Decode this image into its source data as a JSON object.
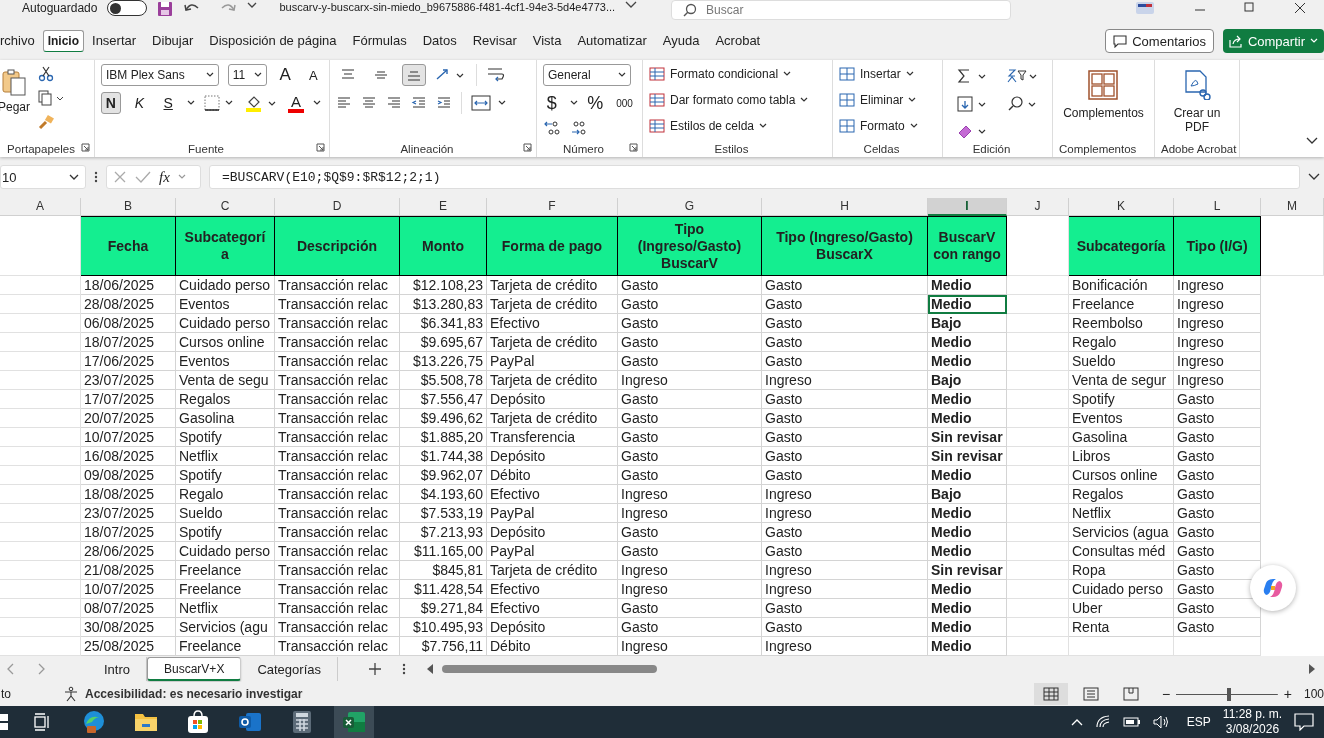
{
  "title_bar": {
    "autosave_label": "Autoguardado",
    "autosave_on": false,
    "filename": "buscarv-y-buscarx-sin-miedo_b9675886-f481-4cf1-94e3-5d4e4773...",
    "search_placeholder": "Buscar"
  },
  "menu_tabs": [
    {
      "label": "rchivo",
      "selected": false
    },
    {
      "label": "Inicio",
      "selected": true
    },
    {
      "label": "Insertar",
      "selected": false
    },
    {
      "label": "Dibujar",
      "selected": false
    },
    {
      "label": "Disposición de página",
      "selected": false
    },
    {
      "label": "Fórmulas",
      "selected": false
    },
    {
      "label": "Datos",
      "selected": false
    },
    {
      "label": "Revisar",
      "selected": false
    },
    {
      "label": "Vista",
      "selected": false
    },
    {
      "label": "Automatizar",
      "selected": false
    },
    {
      "label": "Ayuda",
      "selected": false
    },
    {
      "label": "Acrobat",
      "selected": false
    }
  ],
  "comments_button": "Comentarios",
  "share_button": "Compartir",
  "ribbon": {
    "clipboard": {
      "paste": "Pegar",
      "label": "Portapapeles"
    },
    "font": {
      "family": "IBM Plex Sans",
      "size": "11",
      "grow": "A",
      "shrink": "A",
      "bold": "N",
      "italic": "K",
      "underline": "S",
      "font_color": "A",
      "label": "Fuente"
    },
    "alignment": {
      "vertical_align": [
        {
          "selected": false
        },
        {
          "selected": false
        },
        {
          "selected": true
        }
      ],
      "label": "Alineación"
    },
    "number": {
      "format": "General",
      "currency": "$",
      "percent": "%",
      "thousands": "000",
      "label": "Número"
    },
    "styles": {
      "items": [
        "Formato condicional",
        "Dar formato como tabla",
        "Estilos de celda"
      ],
      "label": "Estilos"
    },
    "cells": {
      "items": [
        "Insertar",
        "Eliminar",
        "Formato"
      ],
      "label": "Celdas"
    },
    "editing": {
      "label": "Edición"
    },
    "addins": {
      "button": "Complementos",
      "label": "Complementos"
    },
    "acrobat": {
      "button": "Crear un PDF",
      "label": "Adobe Acrobat"
    }
  },
  "formula_bar": {
    "cell_ref": "10",
    "fx_label": "fx",
    "formula": "=BUSCARV(E10;$Q$9:$R$12;2;1)"
  },
  "columns": [
    {
      "letter": "A",
      "selected": false
    },
    {
      "letter": "B",
      "selected": false
    },
    {
      "letter": "C",
      "selected": false
    },
    {
      "letter": "D",
      "selected": false
    },
    {
      "letter": "E",
      "selected": false
    },
    {
      "letter": "F",
      "selected": false
    },
    {
      "letter": "G",
      "selected": false
    },
    {
      "letter": "H",
      "selected": false
    },
    {
      "letter": "I",
      "selected": true
    },
    {
      "letter": "J",
      "selected": false
    },
    {
      "letter": "K",
      "selected": false
    },
    {
      "letter": "L",
      "selected": false
    },
    {
      "letter": "M",
      "selected": false
    }
  ],
  "table_headers": [
    "Fecha",
    "Subcategorí a",
    "Descripción",
    "Monto",
    "Forma de pago",
    "Tipo (Ingreso/Gasto) BuscarV",
    "Tipo (Ingreso/Gasto) BuscarX",
    "BuscarV con rango"
  ],
  "lookup_headers": [
    "Subcategoría",
    "Tipo (I/G)"
  ],
  "rows": [
    {
      "cells": [
        "18/06/2025",
        "Cuidado perso",
        "Transacción relac",
        "$12.108,23",
        "Tarjeta de crédito",
        "Gasto",
        "Gasto",
        "Medio"
      ],
      "lookup": [
        "Bonificación",
        "Ingreso"
      ],
      "selected": false
    },
    {
      "cells": [
        "28/08/2025",
        "Eventos",
        "Transacción relac",
        "$13.280,83",
        "Tarjeta de crédito",
        "Gasto",
        "Gasto",
        "Medio"
      ],
      "lookup": [
        "Freelance",
        "Ingreso"
      ],
      "selected": true
    },
    {
      "cells": [
        "06/08/2025",
        "Cuidado perso",
        "Transacción relac",
        "$6.341,83",
        "Efectivo",
        "Gasto",
        "Gasto",
        "Bajo"
      ],
      "lookup": [
        "Reembolso",
        "Ingreso"
      ],
      "selected": false
    },
    {
      "cells": [
        "18/07/2025",
        "Cursos online",
        "Transacción relac",
        "$9.695,67",
        "Tarjeta de crédito",
        "Gasto",
        "Gasto",
        "Medio"
      ],
      "lookup": [
        "Regalo",
        "Ingreso"
      ],
      "selected": false
    },
    {
      "cells": [
        "17/06/2025",
        "Eventos",
        "Transacción relac",
        "$13.226,75",
        "PayPal",
        "Gasto",
        "Gasto",
        "Medio"
      ],
      "lookup": [
        "Sueldo",
        "Ingreso"
      ],
      "selected": false
    },
    {
      "cells": [
        "23/07/2025",
        "Venta de segu",
        "Transacción relac",
        "$5.508,78",
        "Tarjeta de crédito",
        "Ingreso",
        "Ingreso",
        "Bajo"
      ],
      "lookup": [
        "Venta de segur",
        "Ingreso"
      ],
      "selected": false
    },
    {
      "cells": [
        "17/07/2025",
        "Regalos",
        "Transacción relac",
        "$7.556,47",
        "Depósito",
        "Gasto",
        "Gasto",
        "Medio"
      ],
      "lookup": [
        "Spotify",
        "Gasto"
      ],
      "selected": false
    },
    {
      "cells": [
        "20/07/2025",
        "Gasolina",
        "Transacción relac",
        "$9.496,62",
        "Tarjeta de crédito",
        "Gasto",
        "Gasto",
        "Medio"
      ],
      "lookup": [
        "Eventos",
        "Gasto"
      ],
      "selected": false
    },
    {
      "cells": [
        "10/07/2025",
        "Spotify",
        "Transacción relac",
        "$1.885,20",
        "Transferencia",
        "Gasto",
        "Gasto",
        "Sin revisar"
      ],
      "lookup": [
        "Gasolina",
        "Gasto"
      ],
      "selected": false
    },
    {
      "cells": [
        "16/08/2025",
        "Netflix",
        "Transacción relac",
        "$1.744,38",
        "Depósito",
        "Gasto",
        "Gasto",
        "Sin revisar"
      ],
      "lookup": [
        "Libros",
        "Gasto"
      ],
      "selected": false
    },
    {
      "cells": [
        "09/08/2025",
        "Spotify",
        "Transacción relac",
        "$9.962,07",
        "Débito",
        "Gasto",
        "Gasto",
        "Medio"
      ],
      "lookup": [
        "Cursos online",
        "Gasto"
      ],
      "selected": false
    },
    {
      "cells": [
        "18/08/2025",
        "Regalo",
        "Transacción relac",
        "$4.193,60",
        "Efectivo",
        "Ingreso",
        "Ingreso",
        "Bajo"
      ],
      "lookup": [
        "Regalos",
        "Gasto"
      ],
      "selected": false
    },
    {
      "cells": [
        "23/07/2025",
        "Sueldo",
        "Transacción relac",
        "$7.533,19",
        "PayPal",
        "Ingreso",
        "Ingreso",
        "Medio"
      ],
      "lookup": [
        "Netflix",
        "Gasto"
      ],
      "selected": false
    },
    {
      "cells": [
        "18/07/2025",
        "Spotify",
        "Transacción relac",
        "$7.213,93",
        "Depósito",
        "Gasto",
        "Gasto",
        "Medio"
      ],
      "lookup": [
        "Servicios (agua",
        "Gasto"
      ],
      "selected": false
    },
    {
      "cells": [
        "28/06/2025",
        "Cuidado perso",
        "Transacción relac",
        "$11.165,00",
        "PayPal",
        "Gasto",
        "Gasto",
        "Medio"
      ],
      "lookup": [
        "Consultas méd",
        "Gasto"
      ],
      "selected": false
    },
    {
      "cells": [
        "21/08/2025",
        "Freelance",
        "Transacción relac",
        "$845,81",
        "Tarjeta de crédito",
        "Ingreso",
        "Ingreso",
        "Sin revisar"
      ],
      "lookup": [
        "Ropa",
        "Gasto"
      ],
      "selected": false
    },
    {
      "cells": [
        "10/07/2025",
        "Freelance",
        "Transacción relac",
        "$11.428,54",
        "Efectivo",
        "Ingreso",
        "Ingreso",
        "Medio"
      ],
      "lookup": [
        "Cuidado perso",
        "Gasto"
      ],
      "selected": false
    },
    {
      "cells": [
        "08/07/2025",
        "Netflix",
        "Transacción relac",
        "$9.271,84",
        "Efectivo",
        "Gasto",
        "Gasto",
        "Medio"
      ],
      "lookup": [
        "Uber",
        "Gasto"
      ],
      "selected": false
    },
    {
      "cells": [
        "30/08/2025",
        "Servicios (agu",
        "Transacción relac",
        "$10.495,93",
        "Depósito",
        "Gasto",
        "Gasto",
        "Medio"
      ],
      "lookup": [
        "Renta",
        "Gasto"
      ],
      "selected": false
    },
    {
      "cells": [
        "25/08/2025",
        "Freelance",
        "Transacción relac",
        "$7.756,11",
        "Débito",
        "Ingreso",
        "Ingreso",
        "Medio"
      ],
      "selected": false
    }
  ],
  "sheet_tabs": [
    {
      "label": "Intro",
      "selected": false
    },
    {
      "label": "BuscarV+X",
      "selected": true
    },
    {
      "label": "Categorías",
      "selected": false
    }
  ],
  "status_bar": {
    "mode": "to",
    "accessibility": "Accesibilidad: es necesario investigar",
    "views": [
      {
        "selected": true
      },
      {
        "selected": false
      },
      {
        "selected": false
      }
    ],
    "zoom_out": "−",
    "zoom_slider": {
      "level": 0.5
    },
    "zoom_in": "+",
    "zoom": "100"
  },
  "taskbar": {
    "language": "ESP",
    "time": "11:28 p. m.",
    "date": "3/08/2026"
  }
}
